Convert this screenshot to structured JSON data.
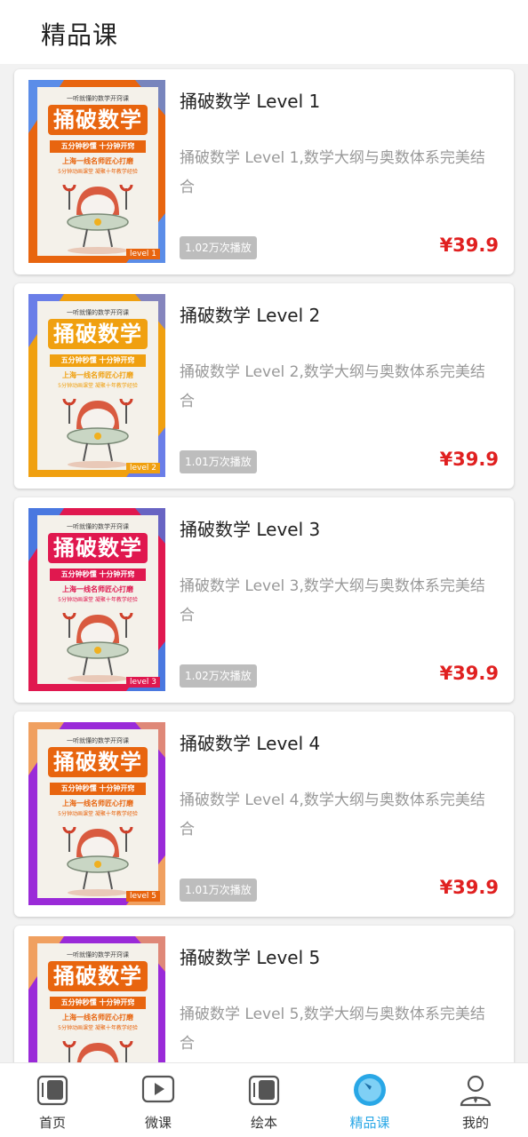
{
  "header": {
    "title": "精品课"
  },
  "courses": [
    {
      "title": "捅破数学 Level 1",
      "description": "捅破数学 Level 1,数学大纲与奥数体系完美结合",
      "plays": "1.02万次播放",
      "price": "¥39.9",
      "cover": {
        "tagline": "一听就懂的数学开窍课",
        "headline": "捅破数学",
        "ribbon": "五分钟秒懂 十分钟开窍",
        "line1": "上海一线名师匠心打磨",
        "line2": "5分钟动画课堂 凝聚十年教学经验",
        "level": "level 1",
        "accent": "#e8650f",
        "frame": "#e8650f",
        "stripe": "#5b8de8"
      }
    },
    {
      "title": "捅破数学 Level 2",
      "description": "捅破数学 Level 2,数学大纲与奥数体系完美结合",
      "plays": "1.01万次播放",
      "price": "¥39.9",
      "cover": {
        "tagline": "一听就懂的数学开窍课",
        "headline": "捅破数学",
        "ribbon": "五分钟秒懂 十分钟开窍",
        "line1": "上海一线名师匠心打磨",
        "line2": "5分钟动画课堂 凝聚十年教学经验",
        "level": "level 2",
        "accent": "#f0a010",
        "frame": "#f0a010",
        "stripe": "#6a7ee8"
      }
    },
    {
      "title": "捅破数学 Level 3",
      "description": "捅破数学 Level 3,数学大纲与奥数体系完美结合",
      "plays": "1.02万次播放",
      "price": "¥39.9",
      "cover": {
        "tagline": "一听就懂的数学开窍课",
        "headline": "捅破数学",
        "ribbon": "五分钟秒懂 十分钟开窍",
        "line1": "上海一线名师匠心打磨",
        "line2": "5分钟动画课堂 凝聚十年教学经验",
        "level": "level 3",
        "accent": "#e0184f",
        "frame": "#e0184f",
        "stripe": "#4a78e0"
      }
    },
    {
      "title": "捅破数学 Level 4",
      "description": "捅破数学 Level 4,数学大纲与奥数体系完美结合",
      "plays": "1.01万次播放",
      "price": "¥39.9",
      "cover": {
        "tagline": "一听就懂的数学开窍课",
        "headline": "捅破数学",
        "ribbon": "五分钟秒懂 十分钟开窍",
        "line1": "上海一线名师匠心打磨",
        "line2": "5分钟动画课堂 凝聚十年教学经验",
        "level": "level 5",
        "accent": "#e8650f",
        "frame": "#9a2ad8",
        "stripe": "#f0a060"
      }
    },
    {
      "title": "捅破数学 Level 5",
      "description": "捅破数学 Level 5,数学大纲与奥数体系完美结合",
      "plays": "",
      "price": "",
      "cover": {
        "tagline": "一听就懂的数学开窍课",
        "headline": "捅破数学",
        "ribbon": "五分钟秒懂 十分钟开窍",
        "line1": "上海一线名师匠心打磨",
        "line2": "5分钟动画课堂 凝聚十年教学经验",
        "level": "",
        "accent": "#e8650f",
        "frame": "#9a2ad8",
        "stripe": "#f0a060"
      }
    }
  ],
  "tabbar": {
    "items": [
      {
        "label": "首页",
        "icon": "home-book-icon"
      },
      {
        "label": "微课",
        "icon": "play-video-icon"
      },
      {
        "label": "绘本",
        "icon": "picture-book-icon"
      },
      {
        "label": "精品课",
        "icon": "compass-icon"
      },
      {
        "label": "我的",
        "icon": "person-icon"
      }
    ],
    "active_index": 3,
    "active_color": "#29a7e6",
    "inactive_color": "#333333"
  }
}
